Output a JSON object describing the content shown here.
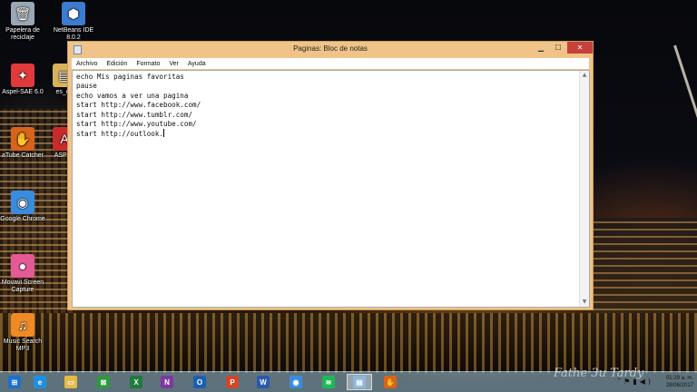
{
  "desktop": {
    "icons": [
      {
        "label": "Papelera de\nreciclaje",
        "icon": "recycle-bin-icon",
        "color": "#9aa7b4",
        "glyph": "🗑"
      },
      {
        "label": "NetBeans IDE\n8.0.2",
        "icon": "netbeans-icon",
        "color": "#3b7bd0",
        "glyph": "⬢"
      },
      {
        "label": "Aspel-SAE 6.0",
        "icon": "aspel-sae-icon",
        "color": "#e23a3a",
        "glyph": "✦"
      },
      {
        "label": "es_off",
        "icon": "office-file-icon",
        "color": "#d8b25a",
        "glyph": "▤"
      },
      {
        "label": "aTube Catcher",
        "icon": "atube-catcher-icon",
        "color": "#d8641c",
        "glyph": "✋"
      },
      {
        "label": "ASPEL",
        "icon": "aspel-icon",
        "color": "#c92a2a",
        "glyph": "A"
      },
      {
        "label": "Google Chrome",
        "icon": "chrome-icon",
        "color": "#3a8dde",
        "glyph": "◉"
      },
      {
        "label": "Movavi Screen\nCapture",
        "icon": "movavi-icon",
        "color": "#e35a95",
        "glyph": "●"
      },
      {
        "label": "Music Search\nMP3",
        "icon": "music-search-icon",
        "color": "#f08a24",
        "glyph": "♫"
      }
    ]
  },
  "notepad": {
    "title": "Paginas: Bloc de notas",
    "menu": [
      "Archivo",
      "Edición",
      "Formato",
      "Ver",
      "Ayuda"
    ],
    "lines": [
      "echo Mis paginas favoritas",
      "pause",
      "echo vamos a ver una pagina",
      "start http://www.facebook.com/",
      "start http://www.tumblr.com/",
      "start http://www.youtube.com/",
      "start http://outlook."
    ]
  },
  "taskbar": {
    "apps": [
      {
        "name": "start-button",
        "color": "#1e6fd0",
        "glyph": "⊞"
      },
      {
        "name": "internet-explorer-icon",
        "color": "#1f8fe0",
        "glyph": "e"
      },
      {
        "name": "file-explorer-icon",
        "color": "#e7b94a",
        "glyph": "▭"
      },
      {
        "name": "store-icon",
        "color": "#2d9a3e",
        "glyph": "⊠"
      },
      {
        "name": "excel-icon",
        "color": "#1f7a3e",
        "glyph": "X"
      },
      {
        "name": "onenote-icon",
        "color": "#7b3a9e",
        "glyph": "N"
      },
      {
        "name": "outlook-icon",
        "color": "#1c5fb0",
        "glyph": "O"
      },
      {
        "name": "powerpoint-icon",
        "color": "#d0472a",
        "glyph": "P"
      },
      {
        "name": "word-icon",
        "color": "#2a5ab0",
        "glyph": "W"
      },
      {
        "name": "chrome-icon",
        "color": "#3a8dde",
        "glyph": "◉"
      },
      {
        "name": "spotify-icon",
        "color": "#1db954",
        "glyph": "≋"
      },
      {
        "name": "notepad-icon",
        "color": "#8fb7d8",
        "glyph": "▤"
      },
      {
        "name": "atube-catcher-icon",
        "color": "#d8641c",
        "glyph": "✋"
      }
    ],
    "time": "01:29 a. m.",
    "date": "28/06/2017"
  },
  "watermark": "Fathe 3u Tardy"
}
